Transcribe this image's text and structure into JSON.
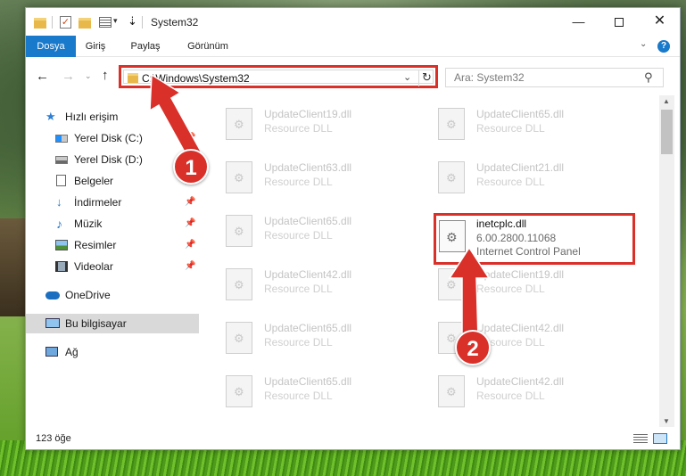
{
  "window": {
    "title": "System32",
    "controls": {
      "minimize": "—",
      "maximize": "",
      "close": "✕"
    }
  },
  "quick_access_toolbar": {
    "check_glyph": "✓",
    "dropdown_glyph": "▾",
    "arrow_glyph": "⇣"
  },
  "ribbon": {
    "tabs": [
      "Dosya",
      "Giriş",
      "Paylaş",
      "Görünüm"
    ],
    "collapse_glyph": "⌄",
    "help_glyph": "?"
  },
  "nav": {
    "back_glyph": "←",
    "forward_glyph": "→",
    "history_glyph": "⌄",
    "up_glyph": "↑"
  },
  "address_bar": {
    "path": "C:\\Windows\\System32",
    "chevron_glyph": "⌄",
    "refresh_glyph": "↻"
  },
  "search": {
    "placeholder": "Ara: System32",
    "icon_glyph": "⚲"
  },
  "sidebar": {
    "items": [
      {
        "label": "Hızlı erişim",
        "icon": "star-icon",
        "pinned": false,
        "selected": false
      },
      {
        "label": "Yerel Disk (C:)",
        "icon": "windows-drive-icon",
        "pinned": true,
        "selected": false
      },
      {
        "label": "Yerel Disk (D:)",
        "icon": "drive-icon",
        "pinned": true,
        "selected": false
      },
      {
        "label": "Belgeler",
        "icon": "documents-icon",
        "pinned": true,
        "selected": false
      },
      {
        "label": "İndirmeler",
        "icon": "download-icon",
        "pinned": true,
        "selected": false
      },
      {
        "label": "Müzik",
        "icon": "music-icon",
        "pinned": true,
        "selected": false
      },
      {
        "label": "Resimler",
        "icon": "pictures-icon",
        "pinned": true,
        "selected": false
      },
      {
        "label": "Videolar",
        "icon": "videos-icon",
        "pinned": true,
        "selected": false
      },
      {
        "label": "OneDrive",
        "icon": "onedrive-icon",
        "pinned": false,
        "selected": false
      },
      {
        "label": "Bu bilgisayar",
        "icon": "this-pc-icon",
        "pinned": false,
        "selected": true
      },
      {
        "label": "Ağ",
        "icon": "network-icon",
        "pinned": false,
        "selected": false
      }
    ],
    "pin_glyph": "📌",
    "star_glyph": "★",
    "download_glyph": "↓",
    "music_glyph": "♪"
  },
  "files": {
    "faded": [
      {
        "name": "UpdateClient19.dll",
        "desc": "Resource DLL"
      },
      {
        "name": "UpdateClient65.dll",
        "desc": "Resource DLL"
      },
      {
        "name": "UpdateClient63.dll",
        "desc": "Resource DLL"
      },
      {
        "name": "UpdateClient21.dll",
        "desc": "Resource DLL"
      },
      {
        "name": "UpdateClient65.dll",
        "desc": "Resource DLL"
      },
      {
        "name": "UpdateClient42.dll",
        "desc": "Resource DLL"
      },
      {
        "name": "UpdateClient19.dll",
        "desc": "Resource DLL"
      },
      {
        "name": "UpdateClient65.dll",
        "desc": "Resource DLL"
      },
      {
        "name": "UpdateClient42.dll",
        "desc": "Resource DLL"
      },
      {
        "name": "UpdateClient65.dll",
        "desc": "Resource DLL"
      },
      {
        "name": "UpdateClient42.dll",
        "desc": "Resource DLL"
      }
    ],
    "highlighted": {
      "name": "inetcplc.dll",
      "version": "6.00.2800.11068",
      "description": "Internet Control Panel"
    }
  },
  "scrollbar": {
    "up_glyph": "▲",
    "down_glyph": "▼"
  },
  "status_bar": {
    "item_count": "123 öğe"
  },
  "annotations": {
    "step1": "1",
    "step2": "2",
    "color": "#d9302a"
  },
  "colors": {
    "accent": "#1979ca",
    "highlight": "#d9302a",
    "selected_nav": "#d9d9d9"
  }
}
